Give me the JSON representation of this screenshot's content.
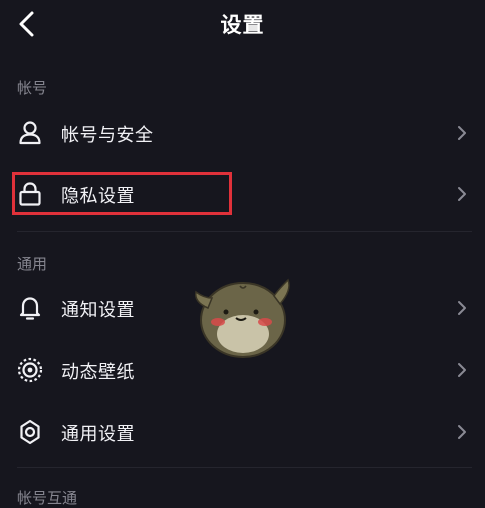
{
  "header": {
    "title": "设置",
    "back_icon": "chevron-left-icon"
  },
  "sections": [
    {
      "title": "帐号",
      "items": [
        {
          "label": "帐号与安全",
          "icon": "user-icon"
        },
        {
          "label": "隐私设置",
          "icon": "lock-icon"
        }
      ]
    },
    {
      "title": "通用",
      "items": [
        {
          "label": "通知设置",
          "icon": "bell-icon"
        },
        {
          "label": "动态壁纸",
          "icon": "live-wallpaper-icon"
        },
        {
          "label": "通用设置",
          "icon": "gear-icon"
        }
      ]
    },
    {
      "title": "帐号互通",
      "items": []
    }
  ],
  "highlight": {
    "target": "隐私设置",
    "color": "#e0313a"
  },
  "colors": {
    "background": "#16161e",
    "text": "#f1f1f5",
    "section_title": "#85858f",
    "chevron": "#8a8a94"
  }
}
